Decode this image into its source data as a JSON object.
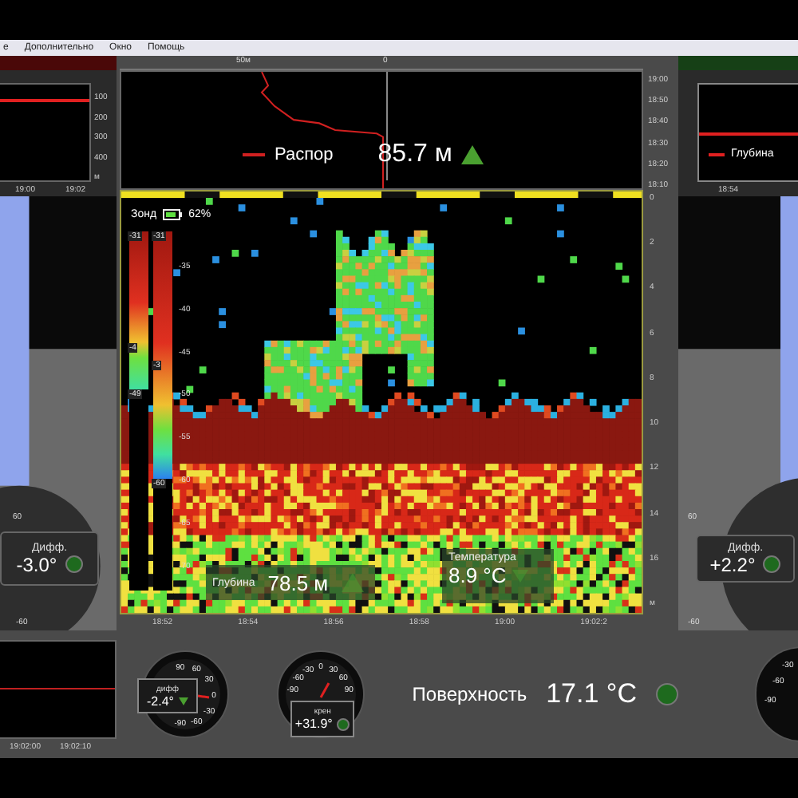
{
  "menu": [
    {
      "label": "е"
    },
    {
      "label": "Дополнительно"
    },
    {
      "label": "Окно"
    },
    {
      "label": "Помощь"
    }
  ],
  "left_panel": {
    "chart": {
      "yticks": [
        "100",
        "200",
        "300",
        "400"
      ],
      "yunit": "м",
      "xticks": [
        "19:00",
        "19:02"
      ]
    },
    "diff": {
      "label": "Дифф.",
      "value": "-3.0°",
      "ticks": [
        "60",
        "-60"
      ]
    },
    "bottom_chart": {
      "xticks": [
        "19:02:00",
        "19:02:10"
      ]
    }
  },
  "spread": {
    "scale": [
      "50м",
      "0"
    ],
    "legend": "Распор",
    "value": "85.7 м",
    "times": [
      "19:00",
      "18:50",
      "18:40",
      "18:30",
      "18:20",
      "18:10"
    ]
  },
  "right_panel": {
    "chart": {
      "legend": "Глубина",
      "xticks": [
        "18:54"
      ]
    },
    "diff": {
      "label": "Дифф.",
      "value": "+2.2°",
      "ticks": [
        "60",
        "-60"
      ]
    },
    "partial_gauge": {
      "ticks": [
        "-30",
        "-60",
        "-90"
      ]
    }
  },
  "sonar": {
    "probe": "Зонд",
    "battery": "62%",
    "bars": [
      {
        "ticks": [
          "-31",
          "-4",
          "-49"
        ]
      },
      {
        "ticks": [
          "-31",
          "-3",
          "-60"
        ]
      }
    ],
    "scale": [
      "-35",
      "-40",
      "-45",
      "-50",
      "-55",
      "-60",
      "-65",
      "-70"
    ],
    "depths": [
      "0",
      "2",
      "4",
      "6",
      "8",
      "10",
      "12",
      "14",
      "16"
    ],
    "depth_unit": "м",
    "times": [
      "18:52",
      "18:54",
      "18:56",
      "18:58",
      "19:00",
      "19:02:2"
    ],
    "depth": {
      "label": "Глубина",
      "value": "78.5 м"
    },
    "temperature": {
      "label": "Температура",
      "value": "8.9 °C"
    }
  },
  "gauges": [
    {
      "kind": "pitch",
      "label": "дифф",
      "value": "-2.4°",
      "ticks": [
        "90",
        "60",
        "30",
        "0",
        "-30",
        "-60",
        "-90"
      ]
    },
    {
      "kind": "roll",
      "label": "крен",
      "value": "+31.9°",
      "ticks": [
        "-90",
        "-60",
        "-30",
        "0",
        "30",
        "60",
        "90"
      ]
    }
  ],
  "surface": {
    "label": "Поверхность",
    "value": "17.1 °C"
  }
}
